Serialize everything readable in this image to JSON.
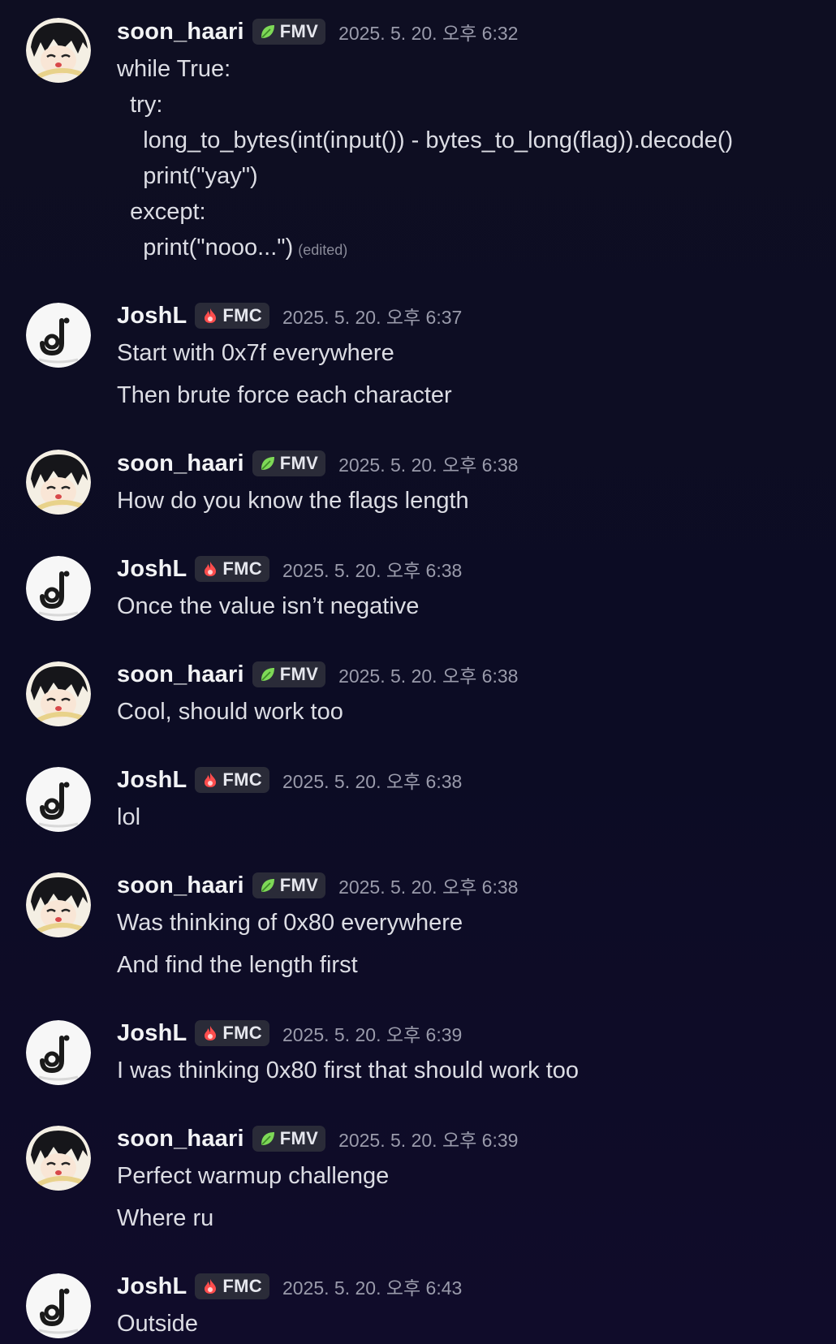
{
  "users": {
    "soon_haari": {
      "name": "soon_haari",
      "tag": "FMV",
      "tag_icon": "leaf-icon"
    },
    "joshl": {
      "name": "JoshL",
      "tag": "FMC",
      "tag_icon": "flame-icon"
    }
  },
  "messages": [
    {
      "author": "soon_haari",
      "timestamp": "2025. 5. 20. 오후 6:32",
      "lines": [
        "while True:",
        "  try:",
        "    long_to_bytes(int(input()) - bytes_to_long(flag)).decode()",
        "    print(\"yay\")",
        "  except:",
        "    print(\"nooo...\")"
      ],
      "edited": "(edited)"
    },
    {
      "author": "JoshL",
      "timestamp": "2025. 5. 20. 오후 6:37",
      "lines": [
        "Start with 0x7f everywhere",
        "Then brute force each character"
      ]
    },
    {
      "author": "soon_haari",
      "timestamp": "2025. 5. 20. 오후 6:38",
      "lines": [
        "How do you know the flags length"
      ]
    },
    {
      "author": "JoshL",
      "timestamp": "2025. 5. 20. 오후 6:38",
      "lines": [
        "Once the value isn’t negative"
      ]
    },
    {
      "author": "soon_haari",
      "timestamp": "2025. 5. 20. 오후 6:38",
      "lines": [
        "Cool, should work too"
      ]
    },
    {
      "author": "JoshL",
      "timestamp": "2025. 5. 20. 오후 6:38",
      "lines": [
        "lol"
      ]
    },
    {
      "author": "soon_haari",
      "timestamp": "2025. 5. 20. 오후 6:38",
      "lines": [
        "Was thinking of 0x80 everywhere",
        "And find the length first"
      ]
    },
    {
      "author": "JoshL",
      "timestamp": "2025. 5. 20. 오후 6:39",
      "lines": [
        "I was thinking 0x80 first that should work too"
      ]
    },
    {
      "author": "soon_haari",
      "timestamp": "2025. 5. 20. 오후 6:39",
      "lines": [
        "Perfect warmup challenge",
        "Where ru"
      ]
    },
    {
      "author": "JoshL",
      "timestamp": "2025. 5. 20. 오후 6:43",
      "lines": [
        "Outside"
      ]
    }
  ],
  "colors": {
    "background": "#0d0d23",
    "username": "#f2f3f5",
    "timestamp": "#9a9bab",
    "tag_bg": "#2a2b38",
    "leaf": "#7ed957",
    "flame": "#ff4d4d"
  }
}
